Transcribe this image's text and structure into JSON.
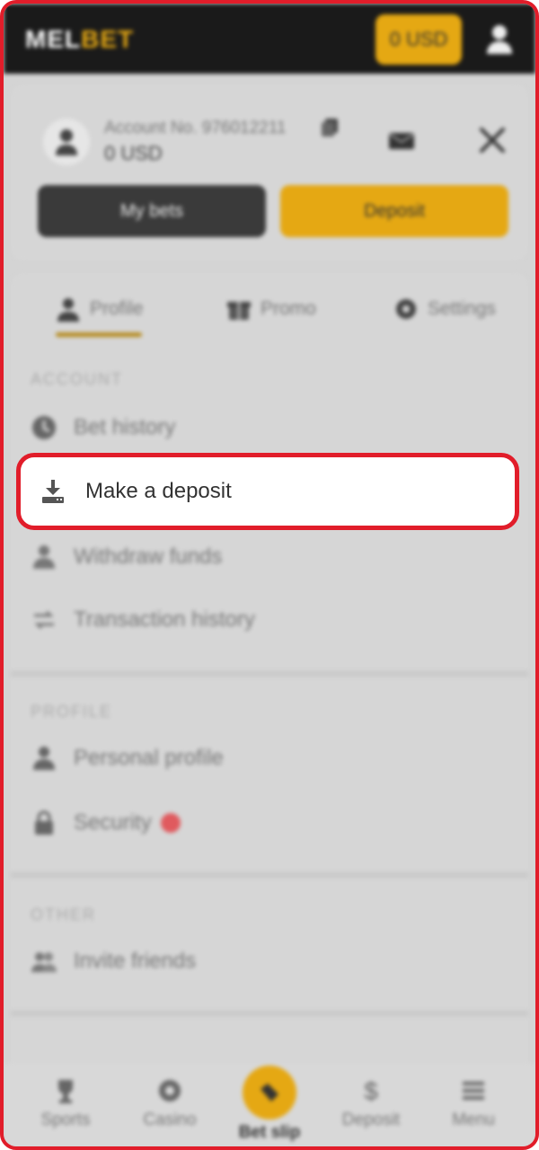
{
  "header": {
    "logo_part1": "MEL",
    "logo_part2": "BET",
    "balance": "0 USD",
    "user_icon": "user-icon"
  },
  "account": {
    "number": "Account No. 976012211",
    "balance": "0 USD",
    "my_bets": "My bets",
    "deposit": "Deposit"
  },
  "tabs": [
    {
      "label": "Profile",
      "icon": "person-icon"
    },
    {
      "label": "Promo",
      "icon": "gift-icon"
    },
    {
      "label": "Settings",
      "icon": "gear-icon"
    }
  ],
  "sections": {
    "account": {
      "title": "ACCOUNT",
      "items": [
        {
          "label": "Bet history",
          "icon": "clock-icon"
        },
        {
          "label": "Make a deposit",
          "icon": "download-icon"
        },
        {
          "label": "Withdraw funds",
          "icon": "withdraw-icon"
        },
        {
          "label": "Transaction history",
          "icon": "transactions-icon"
        }
      ]
    },
    "profile": {
      "title": "PROFILE",
      "items": [
        {
          "label": "Personal profile",
          "icon": "person-icon"
        },
        {
          "label": "Security",
          "icon": "lock-icon"
        }
      ]
    },
    "other": {
      "title": "OTHER",
      "items": [
        {
          "label": "Invite friends",
          "icon": "friends-icon"
        }
      ]
    }
  },
  "bottom_nav": [
    {
      "label": "Sports",
      "icon": "trophy-icon"
    },
    {
      "label": "Casino",
      "icon": "casino-chip-icon"
    },
    {
      "label": "Bet slip",
      "icon": "ticket-icon"
    },
    {
      "label": "Deposit",
      "icon": "dollar-icon"
    },
    {
      "label": "Menu",
      "icon": "menu-icon"
    }
  ],
  "colors": {
    "accent": "#e5a813",
    "highlight_border": "#e11d2a",
    "header_bg": "#1a1a1a",
    "status_dot": "#e05a5e"
  }
}
